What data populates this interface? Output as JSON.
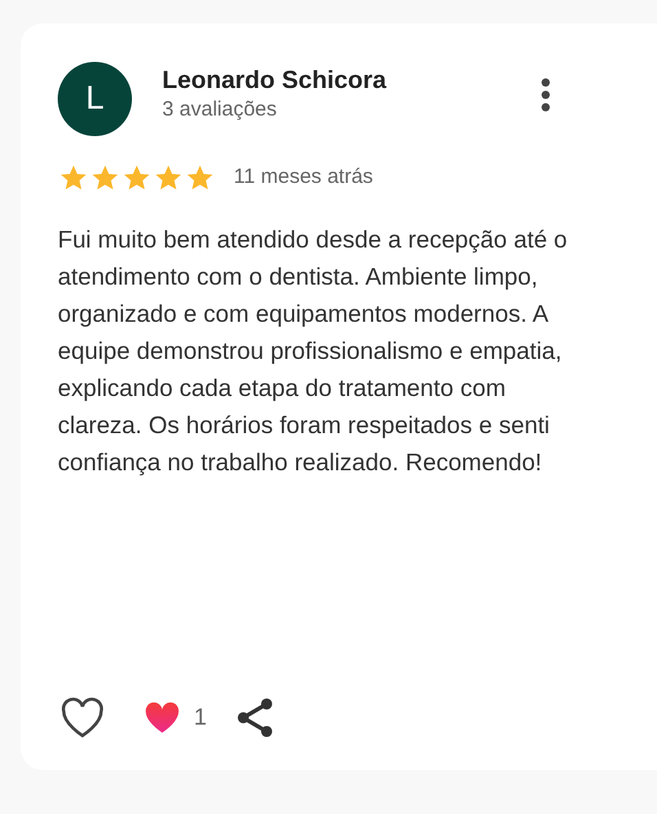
{
  "review": {
    "avatar_letter": "L",
    "author": "Leonardo Schicora",
    "review_count": "3 avaliações",
    "stars": 5,
    "time": "11 meses atrás",
    "text": "Fui muito bem atendido desde a recepção até o atendimento com o dentista. Ambiente limpo, organizado e com equipamentos modernos. A equipe demonstrou profissionalismo e empatia, explicando cada etapa do tratamento com clareza. Os horários foram respeitados e senti confiança no trabalho realizado. Recomendo!",
    "liked": false,
    "reaction_count": "1"
  }
}
